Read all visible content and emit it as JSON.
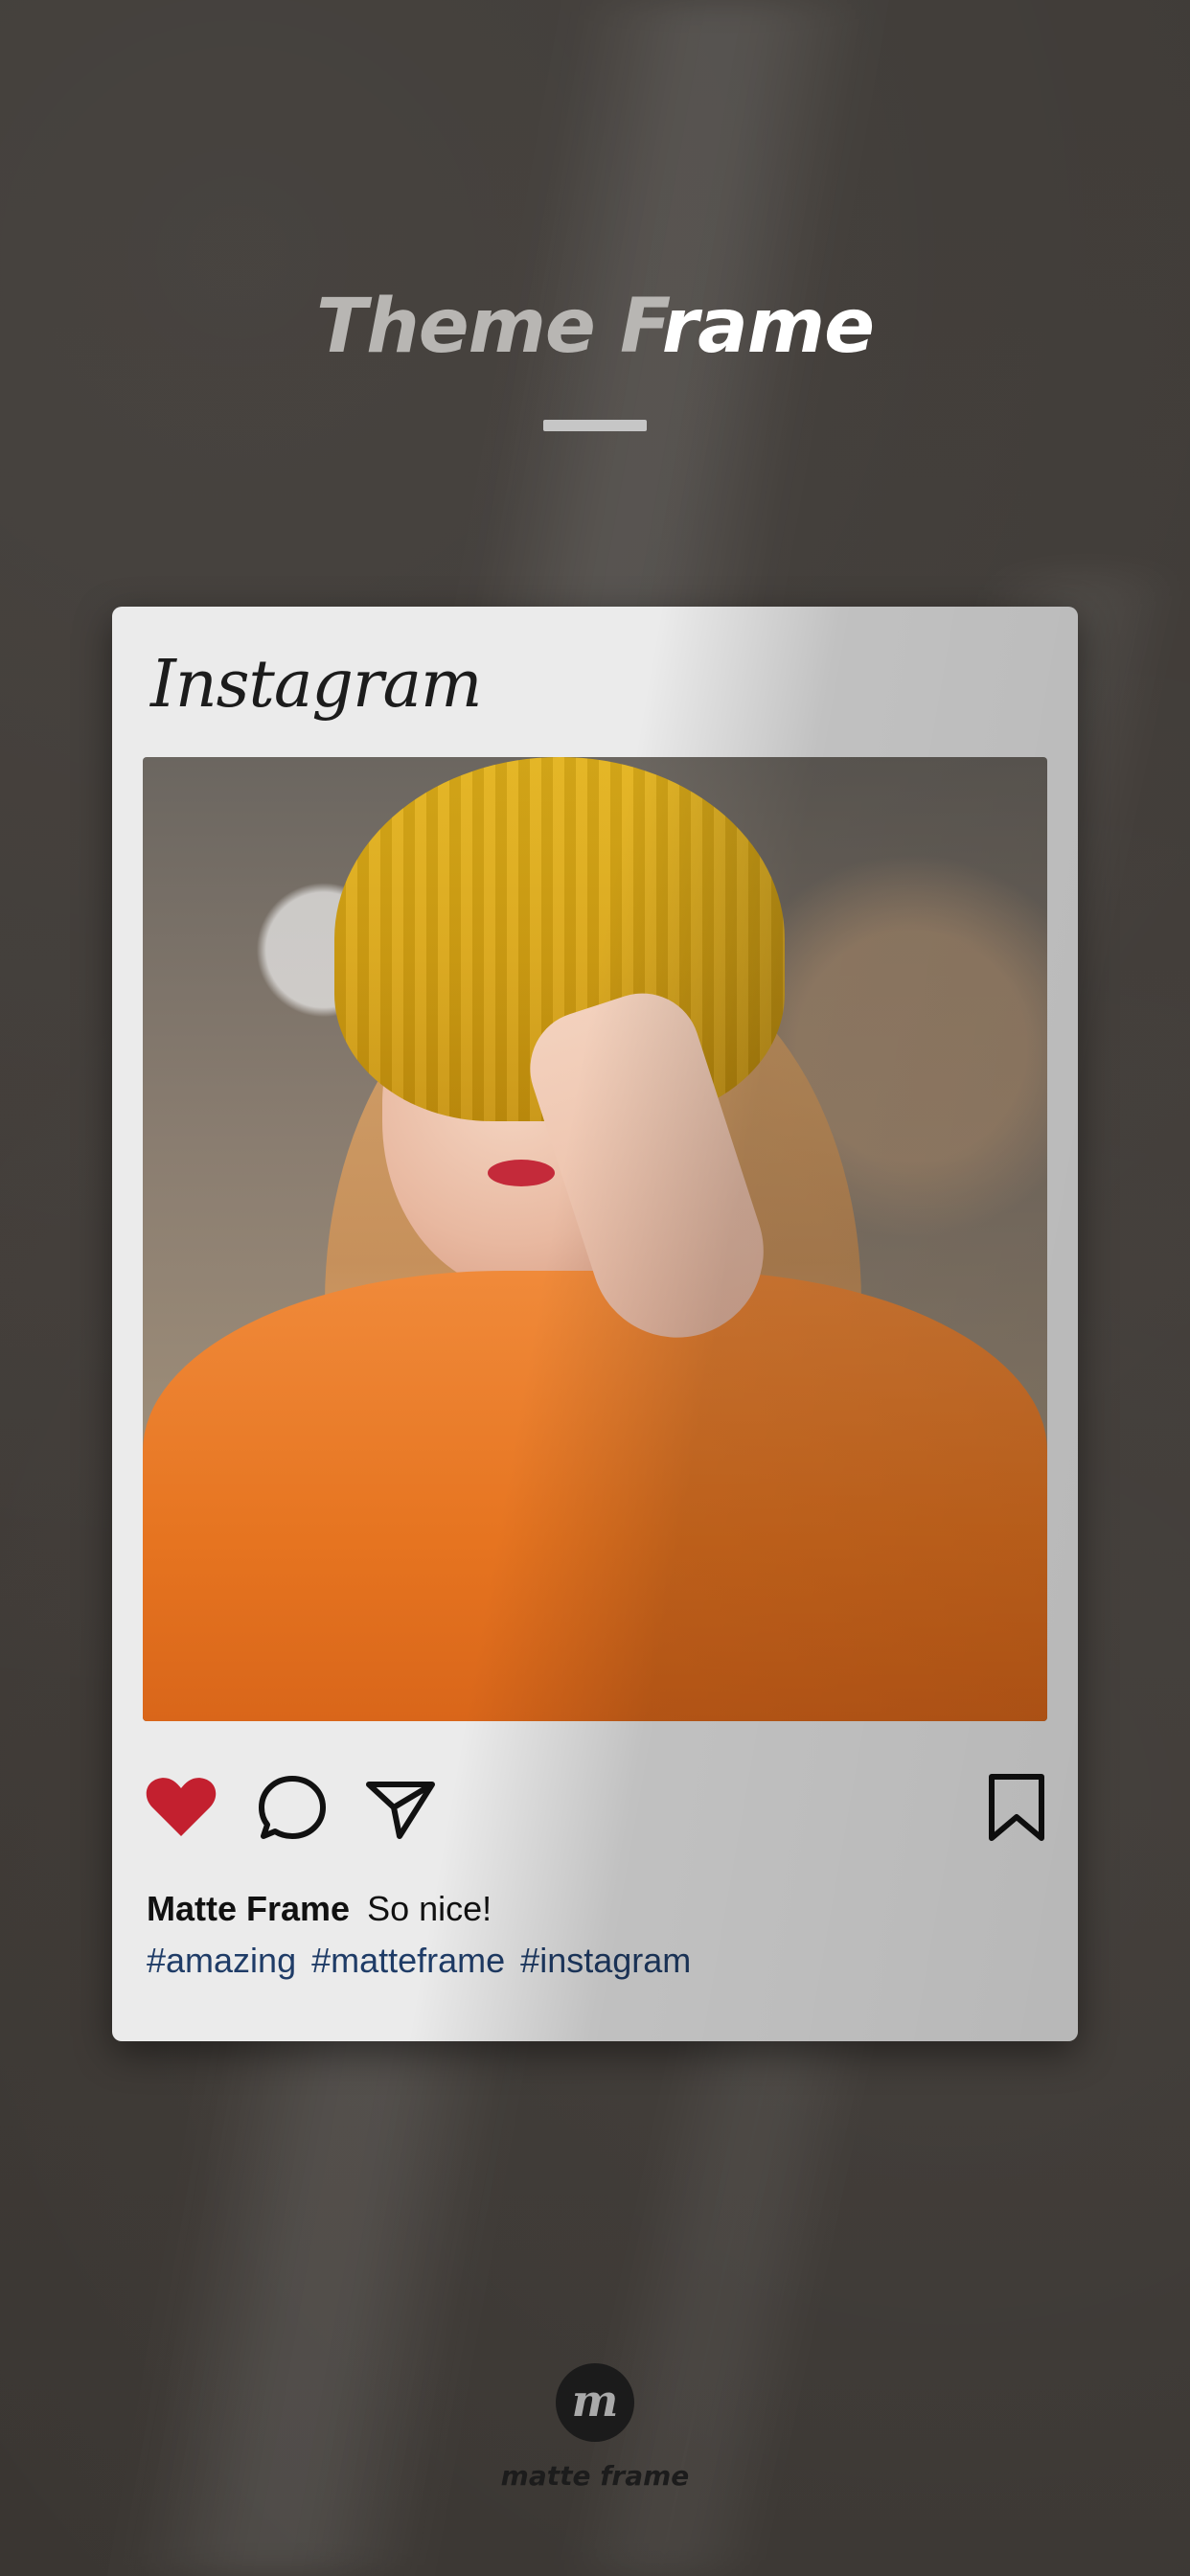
{
  "header": {
    "title_part1": "Theme F",
    "title_part2": "rame"
  },
  "card": {
    "brand": "Instagram",
    "photo_alt": "Portrait photo post",
    "actions": {
      "like_icon": "heart-icon",
      "comment_icon": "comment-icon",
      "share_icon": "share-icon",
      "save_icon": "bookmark-icon",
      "like_color": "#c3202f"
    },
    "caption": {
      "username": "Matte Frame",
      "text": "So nice!"
    },
    "hashtags": [
      "#amazing",
      "#matteframe",
      "#instagram"
    ],
    "hashtag_color": "#1f3c67"
  },
  "footer": {
    "logo_letter": "m",
    "brand": "matte frame"
  }
}
